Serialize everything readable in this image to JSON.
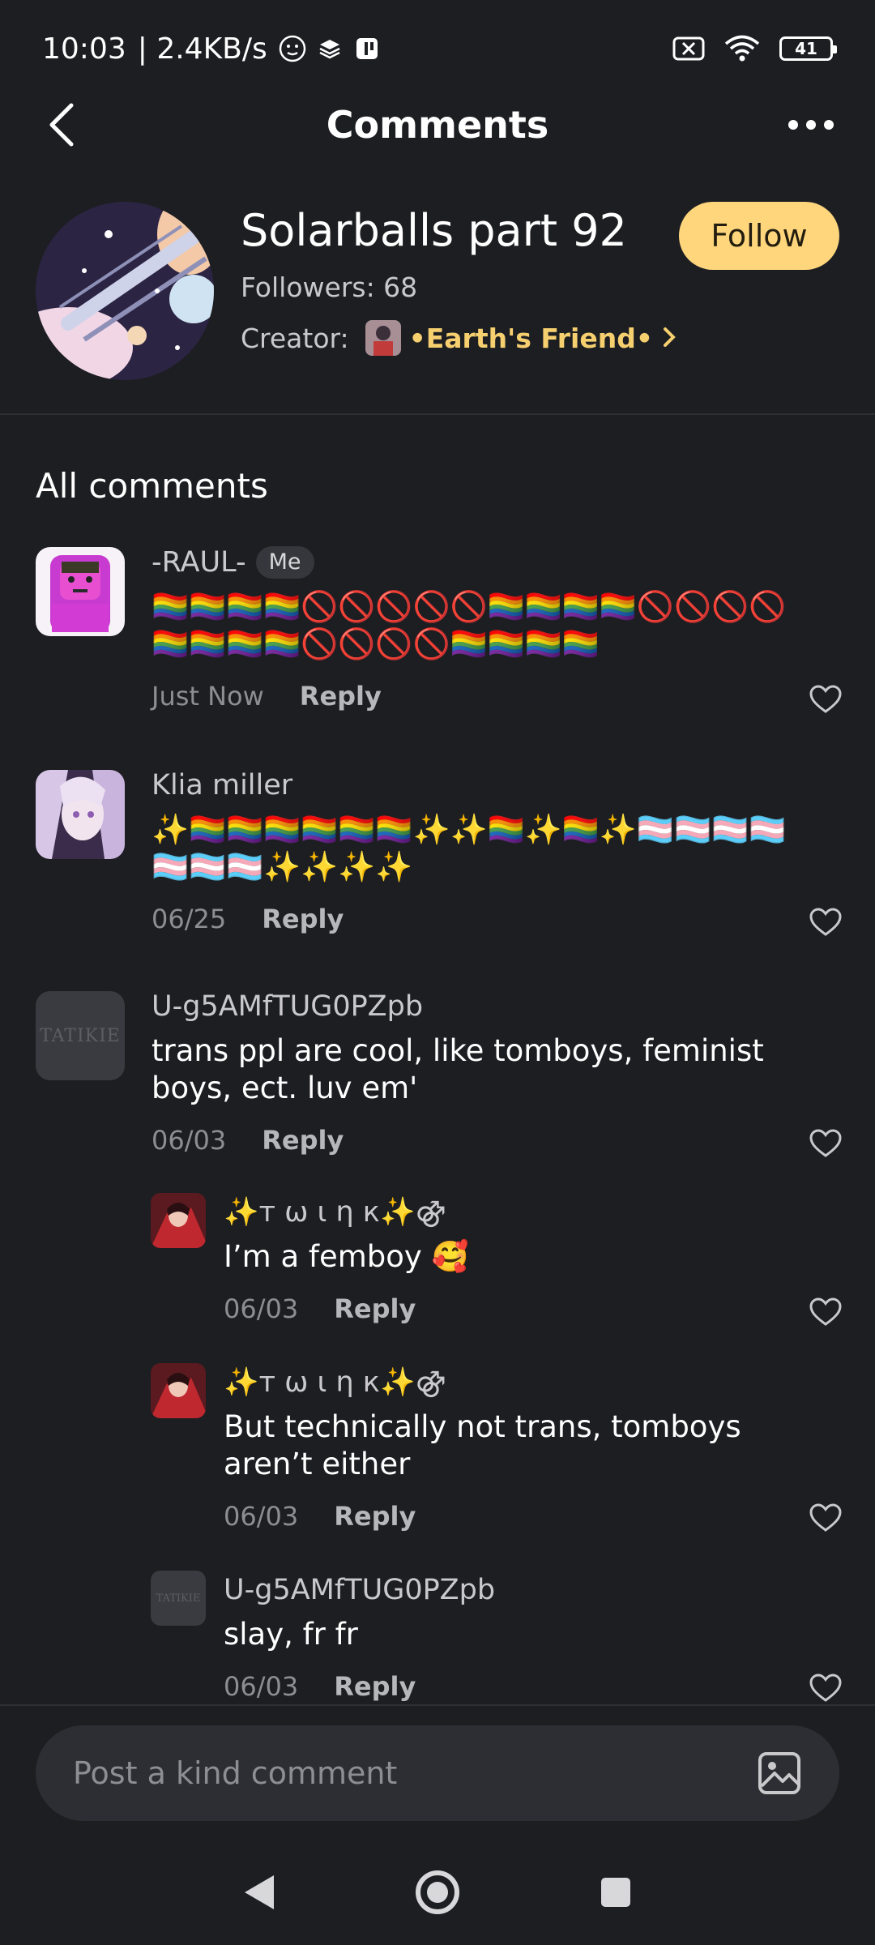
{
  "status_bar": {
    "time": "10:03",
    "speed": "| 2.4KB/s",
    "battery": "41"
  },
  "nav": {
    "title": "Comments"
  },
  "series": {
    "title": "Solarballs part 92",
    "followers": "Followers: 68",
    "creator_label": "Creator:",
    "creator_name": "•Earth's Friend•",
    "follow_label": "Follow"
  },
  "section": {
    "title": "All comments"
  },
  "comments": [
    {
      "author": "-RAUL-",
      "badge": "Me",
      "text": "🏳️‍🌈🏳️‍🌈🏳️‍🌈🏳️‍🌈🚫🚫🚫🚫🚫🏳️‍🌈🏳️‍🌈🏳️‍🌈🏳️‍🌈🚫🚫🚫🚫🏳️‍🌈🏳️‍🌈🏳️‍🌈🏳️‍🌈🚫🚫🚫🚫🏳️‍🌈🏳️‍🌈🏳️‍🌈🏳️‍🌈",
      "date": "Just Now",
      "reply_label": "Reply"
    },
    {
      "author": "Klia miller",
      "text": "✨🏳️‍🌈🏳️‍🌈🏳️‍🌈🏳️‍🌈🏳️‍🌈🏳️‍🌈✨✨🏳️‍🌈✨🏳️‍🌈✨🏳️‍⚧️🏳️‍⚧️🏳️‍⚧️🏳️‍⚧️🏳️‍⚧️🏳️‍⚧️🏳️‍⚧️✨✨✨✨",
      "date": "06/25",
      "reply_label": "Reply"
    },
    {
      "author": "U-g5AMfTUG0PZpb",
      "avatar_text": "TATIKIE",
      "text": "trans ppl are cool, like tomboys, feminist boys, ect. luv em'",
      "date": "06/03",
      "reply_label": "Reply"
    },
    {
      "author": "✨т ω ι η к✨⚣",
      "text": "I’m a femboy 🥰",
      "date": "06/03",
      "reply_label": "Reply"
    },
    {
      "author": "✨т ω ι η к✨⚣",
      "text": "But technically not trans, tomboys aren’t either",
      "date": "06/03",
      "reply_label": "Reply"
    },
    {
      "author": "U-g5AMfTUG0PZpb",
      "avatar_text": "TATIKIE",
      "text": "slay, fr fr",
      "date": "06/03",
      "reply_label": "Reply"
    }
  ],
  "composer": {
    "placeholder": "Post a kind comment"
  },
  "colors": {
    "background": "#1d1e22",
    "accent": "#ffd67c",
    "creator_name": "#f6cf6f"
  },
  "icons": {
    "back": "chevron-left-icon",
    "more": "more-horizontal-icon",
    "like": "heart-icon",
    "image": "image-icon"
  }
}
